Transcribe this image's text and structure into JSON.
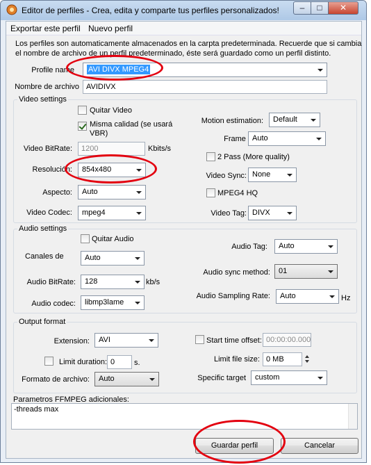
{
  "window": {
    "title": "Editor de perfiles - Crea, edita y comparte tus perfiles personalizados!"
  },
  "menu": {
    "export": "Exportar este perfil",
    "new": "Nuevo perfil"
  },
  "info": {
    "line1": "Los perfiles son automaticamente almacenados en la carpta predeterminada. Recuerde que si cambia",
    "line2": "el nombre de archivo de un perfil predeterminado, éste será guardado como un perfil distinto."
  },
  "profile": {
    "name_label": "Profile name",
    "name_value": "AVI DIVX MPEG4",
    "filename_label": "Nombre de archivo",
    "filename_value": "AVIDIVX"
  },
  "video": {
    "group_title": "Video settings",
    "quit_video": "Quitar Video",
    "same_quality_1": "Misma calidad (se usará",
    "same_quality_2": "VBR)",
    "bitrate_label": "Video BitRate:",
    "bitrate_value": "1200",
    "bitrate_unit": "Kbits/s",
    "resolution_label": "Resolución:",
    "resolution_value": "854x480",
    "aspect_label": "Aspecto:",
    "aspect_value": "Auto",
    "codec_label": "Video Codec:",
    "codec_value": "mpeg4",
    "motion_label": "Motion estimation:",
    "motion_value": "Default",
    "framerate_label": "Frame rate:",
    "framerate_value": "Auto",
    "twopass_label": "2 Pass (More quality)",
    "sync_label": "Video Sync:",
    "sync_value": "None",
    "mpeg4hq_label": "MPEG4 HQ",
    "tag_label": "Video Tag:",
    "tag_value": "DIVX"
  },
  "audio": {
    "group_title": "Audio settings",
    "quit_audio": "Quitar Audio",
    "channels_label": "Canales de",
    "channels_value": "Auto",
    "bitrate_label": "Audio BitRate:",
    "bitrate_value": "128",
    "bitrate_unit": "kb/s",
    "codec_label": "Audio codec:",
    "codec_value": "libmp3lame",
    "tag_label": "Audio Tag:",
    "tag_value": "Auto",
    "sync_label": "Audio sync method:",
    "sync_value": "01",
    "sampling_label": "Audio Sampling Rate:",
    "sampling_value": "Auto",
    "sampling_unit": "Hz"
  },
  "output": {
    "group_title": "Output format",
    "extension_label": "Extension:",
    "extension_value": "AVI",
    "start_offset_label": "Start time offset:",
    "start_offset_value": "00:00:00.000",
    "limit_duration_label": "Limit duration:",
    "limit_duration_value": "0",
    "limit_duration_unit": "s.",
    "limit_size_label": "Limit file size:",
    "limit_size_value": "0 MB",
    "format_label": "Formato de archivo:",
    "format_value": "Auto",
    "target_label": "Specific target",
    "target_value": "custom"
  },
  "ffmpeg": {
    "label": "Parametros FFMPEG adicionales:",
    "value": "-threads max"
  },
  "buttons": {
    "save": "Guardar perfil",
    "cancel": "Cancelar"
  },
  "annotation_color": "#e3000f"
}
